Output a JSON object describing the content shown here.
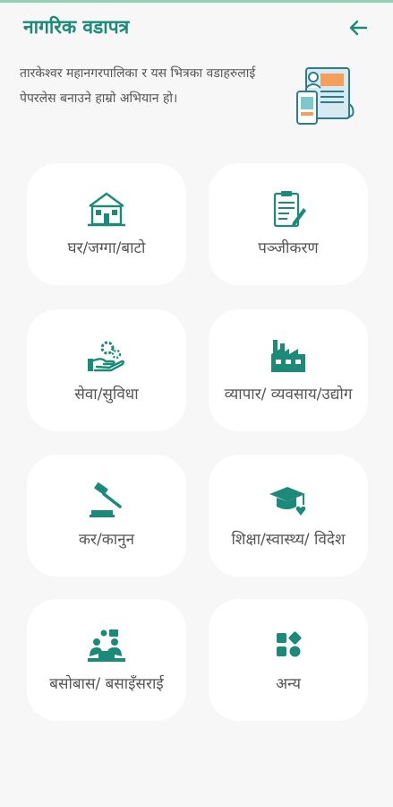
{
  "header": {
    "title": "नागरिक वडापत्र"
  },
  "intro": {
    "text": "तारकेश्वर महानगरपालिका र यस भित्रका वडाहरुलाई पेपरलेस बनाउने हाम्रो अभियान हो।"
  },
  "colors": {
    "accent": "#1b8a78",
    "card": "#ffffff",
    "background": "#f7f7f7"
  },
  "cards": [
    {
      "label": "घर/जग्गा/बाटो",
      "icon": "house-icon"
    },
    {
      "label": "पञ्जीकरण",
      "icon": "clipboard-icon"
    },
    {
      "label": "सेवा/सुविधा",
      "icon": "service-hand-icon"
    },
    {
      "label": "व्यापार/ व्यवसाय/उद्योग",
      "icon": "factory-icon"
    },
    {
      "label": "कर/कानुन",
      "icon": "gavel-icon"
    },
    {
      "label": "शिक्षा/स्वास्थ्य/ विदेश",
      "icon": "graduation-cap-icon"
    },
    {
      "label": "बसोबास/ बसाइँसराई",
      "icon": "residence-icon"
    },
    {
      "label": "अन्य",
      "icon": "grid-icon"
    }
  ]
}
